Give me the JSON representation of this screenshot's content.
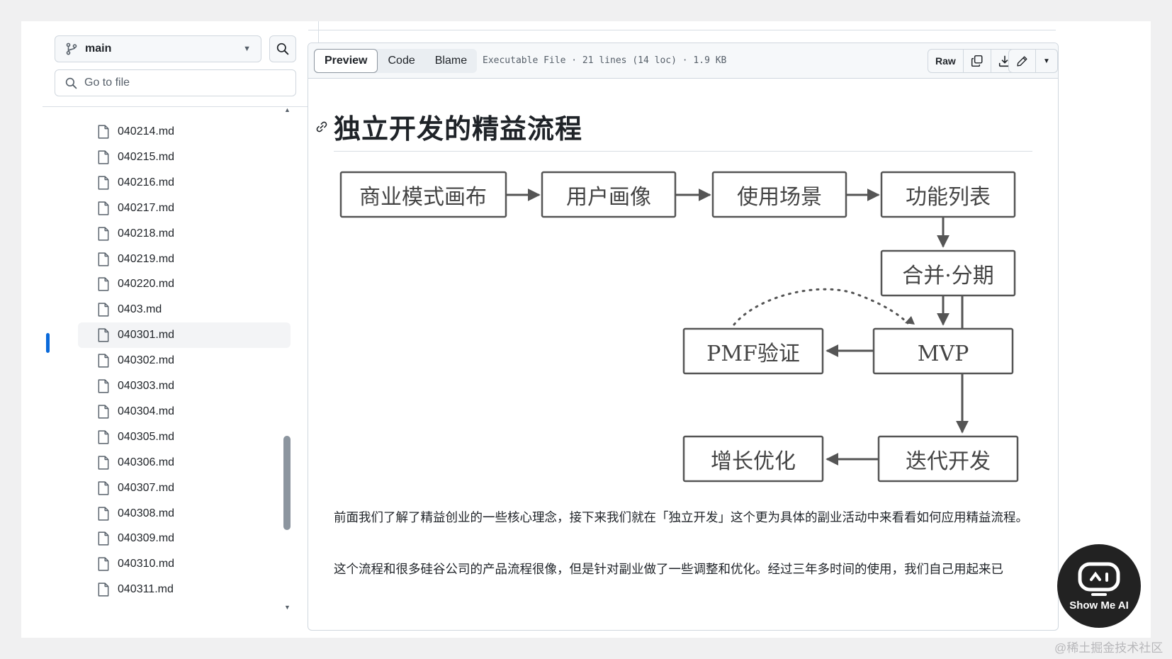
{
  "sidebar": {
    "branch": "main",
    "goto_placeholder": "Go to file",
    "files": [
      "040214.md",
      "040215.md",
      "040216.md",
      "040217.md",
      "040218.md",
      "040219.md",
      "040220.md",
      "0403.md",
      "040301.md",
      "040302.md",
      "040303.md",
      "040304.md",
      "040305.md",
      "040306.md",
      "040307.md",
      "040308.md",
      "040309.md",
      "040310.md",
      "040311.md"
    ],
    "selected": "040301.md"
  },
  "toolbar": {
    "tabs": [
      "Preview",
      "Code",
      "Blame"
    ],
    "active_tab": "Preview",
    "file_info": "Executable File · 21 lines (14 loc) · 1.9 KB",
    "raw_label": "Raw"
  },
  "content": {
    "heading": "独立开发的精益流程",
    "diagram": {
      "boxes": [
        "商业模式画布",
        "用户画像",
        "使用场景",
        "功能列表",
        "合并·分期",
        "PMF验证",
        "MVP",
        "增长优化",
        "迭代开发"
      ]
    },
    "paragraph1": "前面我们了解了精益创业的一些核心理念，接下来我们就在「独立开发」这个更为具体的副业活动中来看看如何应用精益流程。",
    "paragraph2": "这个流程和很多硅谷公司的产品流程很像，但是针对副业做了一些调整和优化。经过三年多时间的使用，我们自己用起来已"
  },
  "overlay": {
    "badge_text": "Show Me AI",
    "watermark": "@稀土掘金技术社区"
  },
  "colors": {
    "accent": "#0969da",
    "border": "#d0d7de",
    "diagram_stroke": "#555555"
  }
}
